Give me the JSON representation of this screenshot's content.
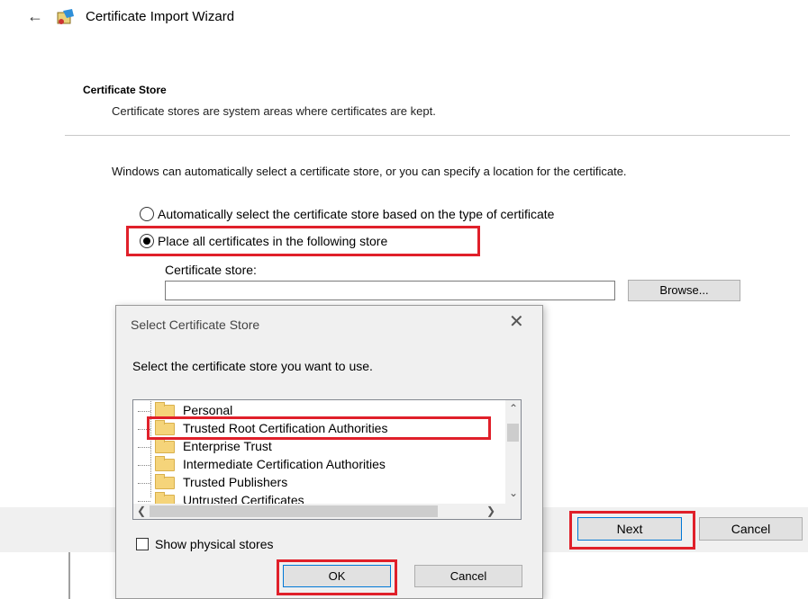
{
  "wizard": {
    "title": "Certificate Import Wizard",
    "section_title": "Certificate Store",
    "section_desc": "Certificate stores are system areas where certificates are kept.",
    "intro": "Windows can automatically select a certificate store, or you can specify a location for the certificate.",
    "radio_auto_label": "Automatically select the certificate store based on the type of certificate",
    "radio_place_label": "Place all certificates in the following store",
    "radio_selected": "place",
    "store_label": "Certificate store:",
    "store_value": "",
    "browse_label": "Browse...",
    "next_label": "Next",
    "cancel_label": "Cancel"
  },
  "dialog": {
    "title": "Select Certificate Store",
    "prompt": "Select the certificate store you want to use.",
    "stores": [
      "Personal",
      "Trusted Root Certification Authorities",
      "Enterprise Trust",
      "Intermediate Certification Authorities",
      "Trusted Publishers",
      "Untrusted Certificates"
    ],
    "selected_store": "Trusted Root Certification Authorities",
    "show_physical_label": "Show physical stores",
    "show_physical_checked": false,
    "ok_label": "OK",
    "cancel_label": "Cancel"
  },
  "colors": {
    "highlight": "#e0202a",
    "default_button_border": "#0078d7"
  }
}
